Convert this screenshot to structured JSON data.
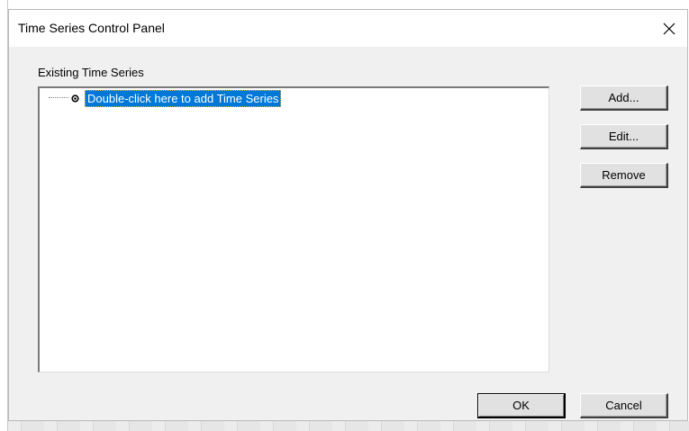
{
  "window": {
    "title": "Time Series Control Panel",
    "close_icon": "close-icon"
  },
  "existing_series": {
    "label": "Existing Time Series",
    "items": [
      {
        "label": "Double-click here to add Time Series",
        "selected": true,
        "icon": "tree-node-icon"
      }
    ]
  },
  "side_buttons": {
    "add": "Add...",
    "edit": "Edit...",
    "remove": "Remove"
  },
  "footer_buttons": {
    "ok": "OK",
    "cancel": "Cancel"
  },
  "colors": {
    "selection_bg": "#0078d7",
    "selection_fg": "#ffffff",
    "dialog_bg": "#f0f0f0"
  }
}
